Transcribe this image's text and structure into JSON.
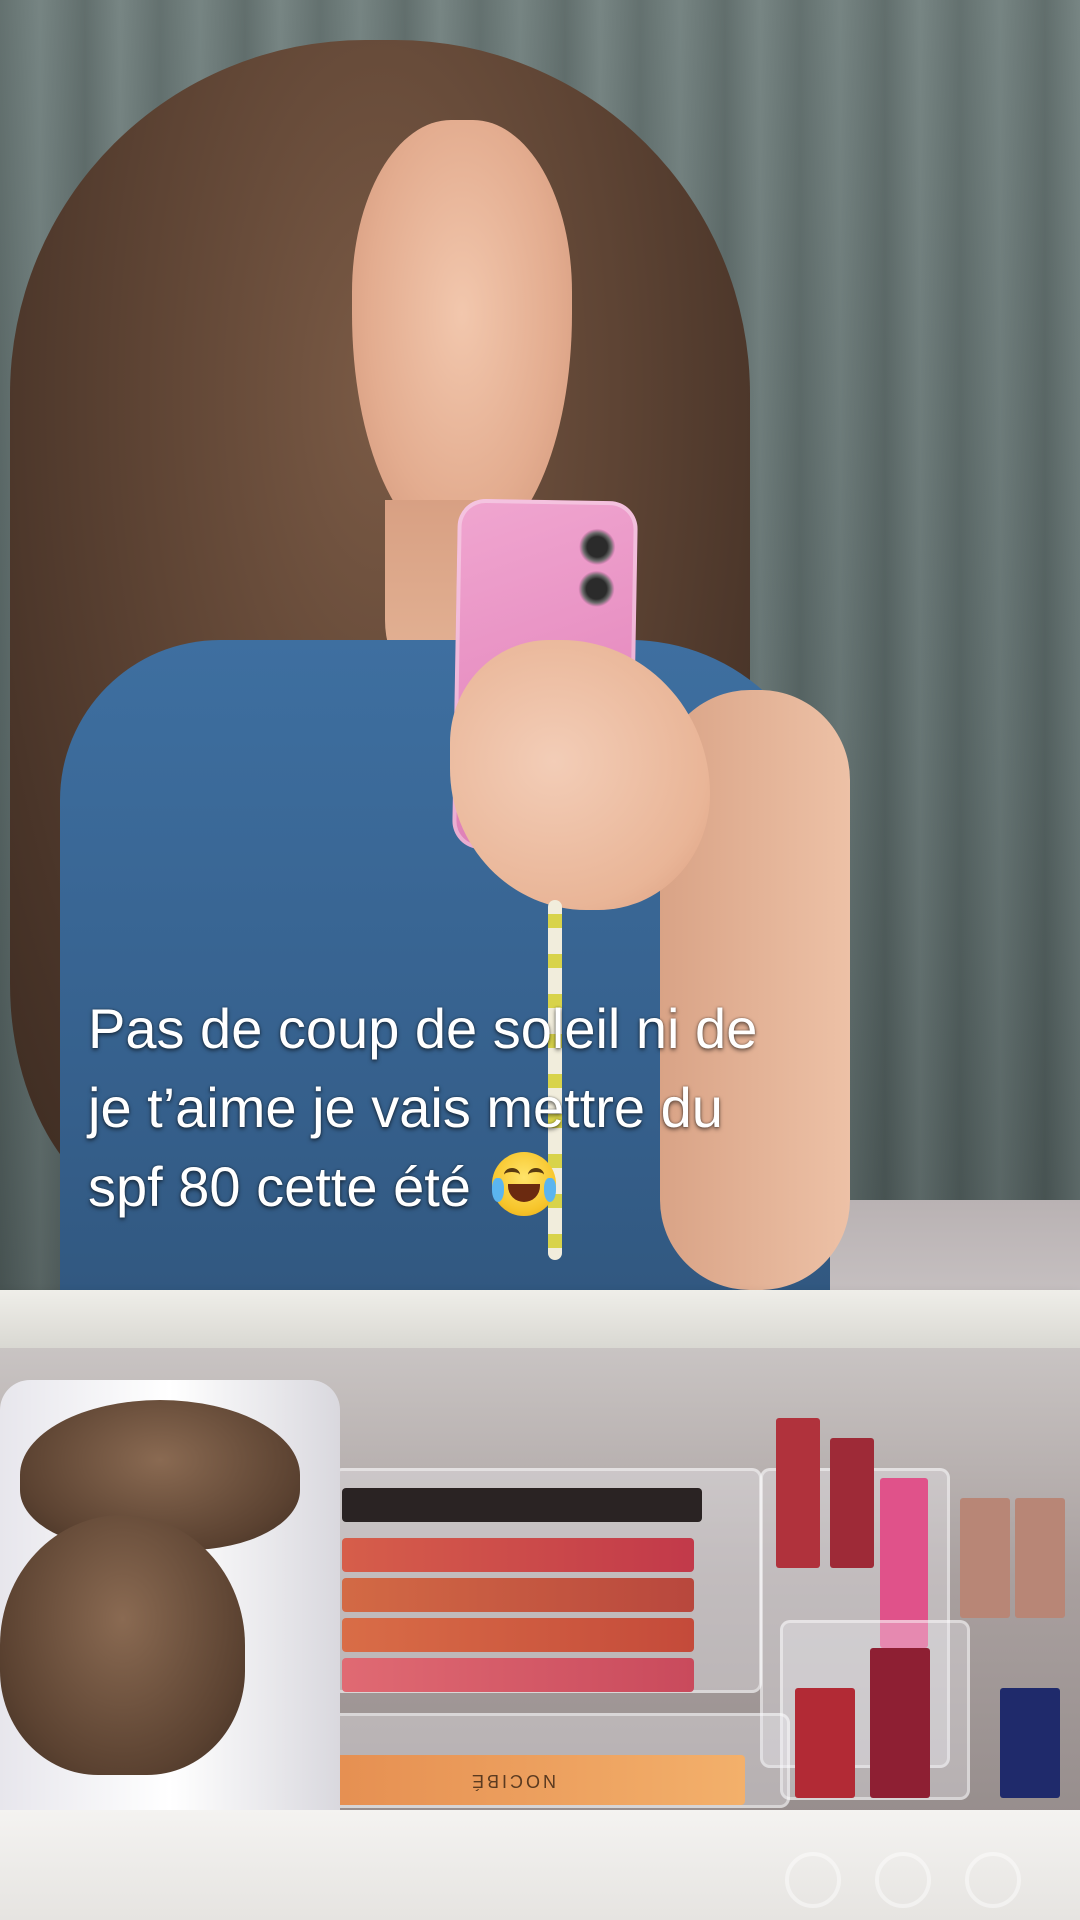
{
  "caption": {
    "line1": "Pas de coup de soleil ni de",
    "line2": "je t’aime je vais mettre du",
    "line3": "spf 80 cette été",
    "emoji": "face-with-tears-of-joy"
  },
  "palette_label": "NOCIBÉ",
  "colors": {
    "caption_text": "#ffffff",
    "curtain": "#65736f",
    "shirt": "#3a6896",
    "phone_case": "#e891c4"
  }
}
